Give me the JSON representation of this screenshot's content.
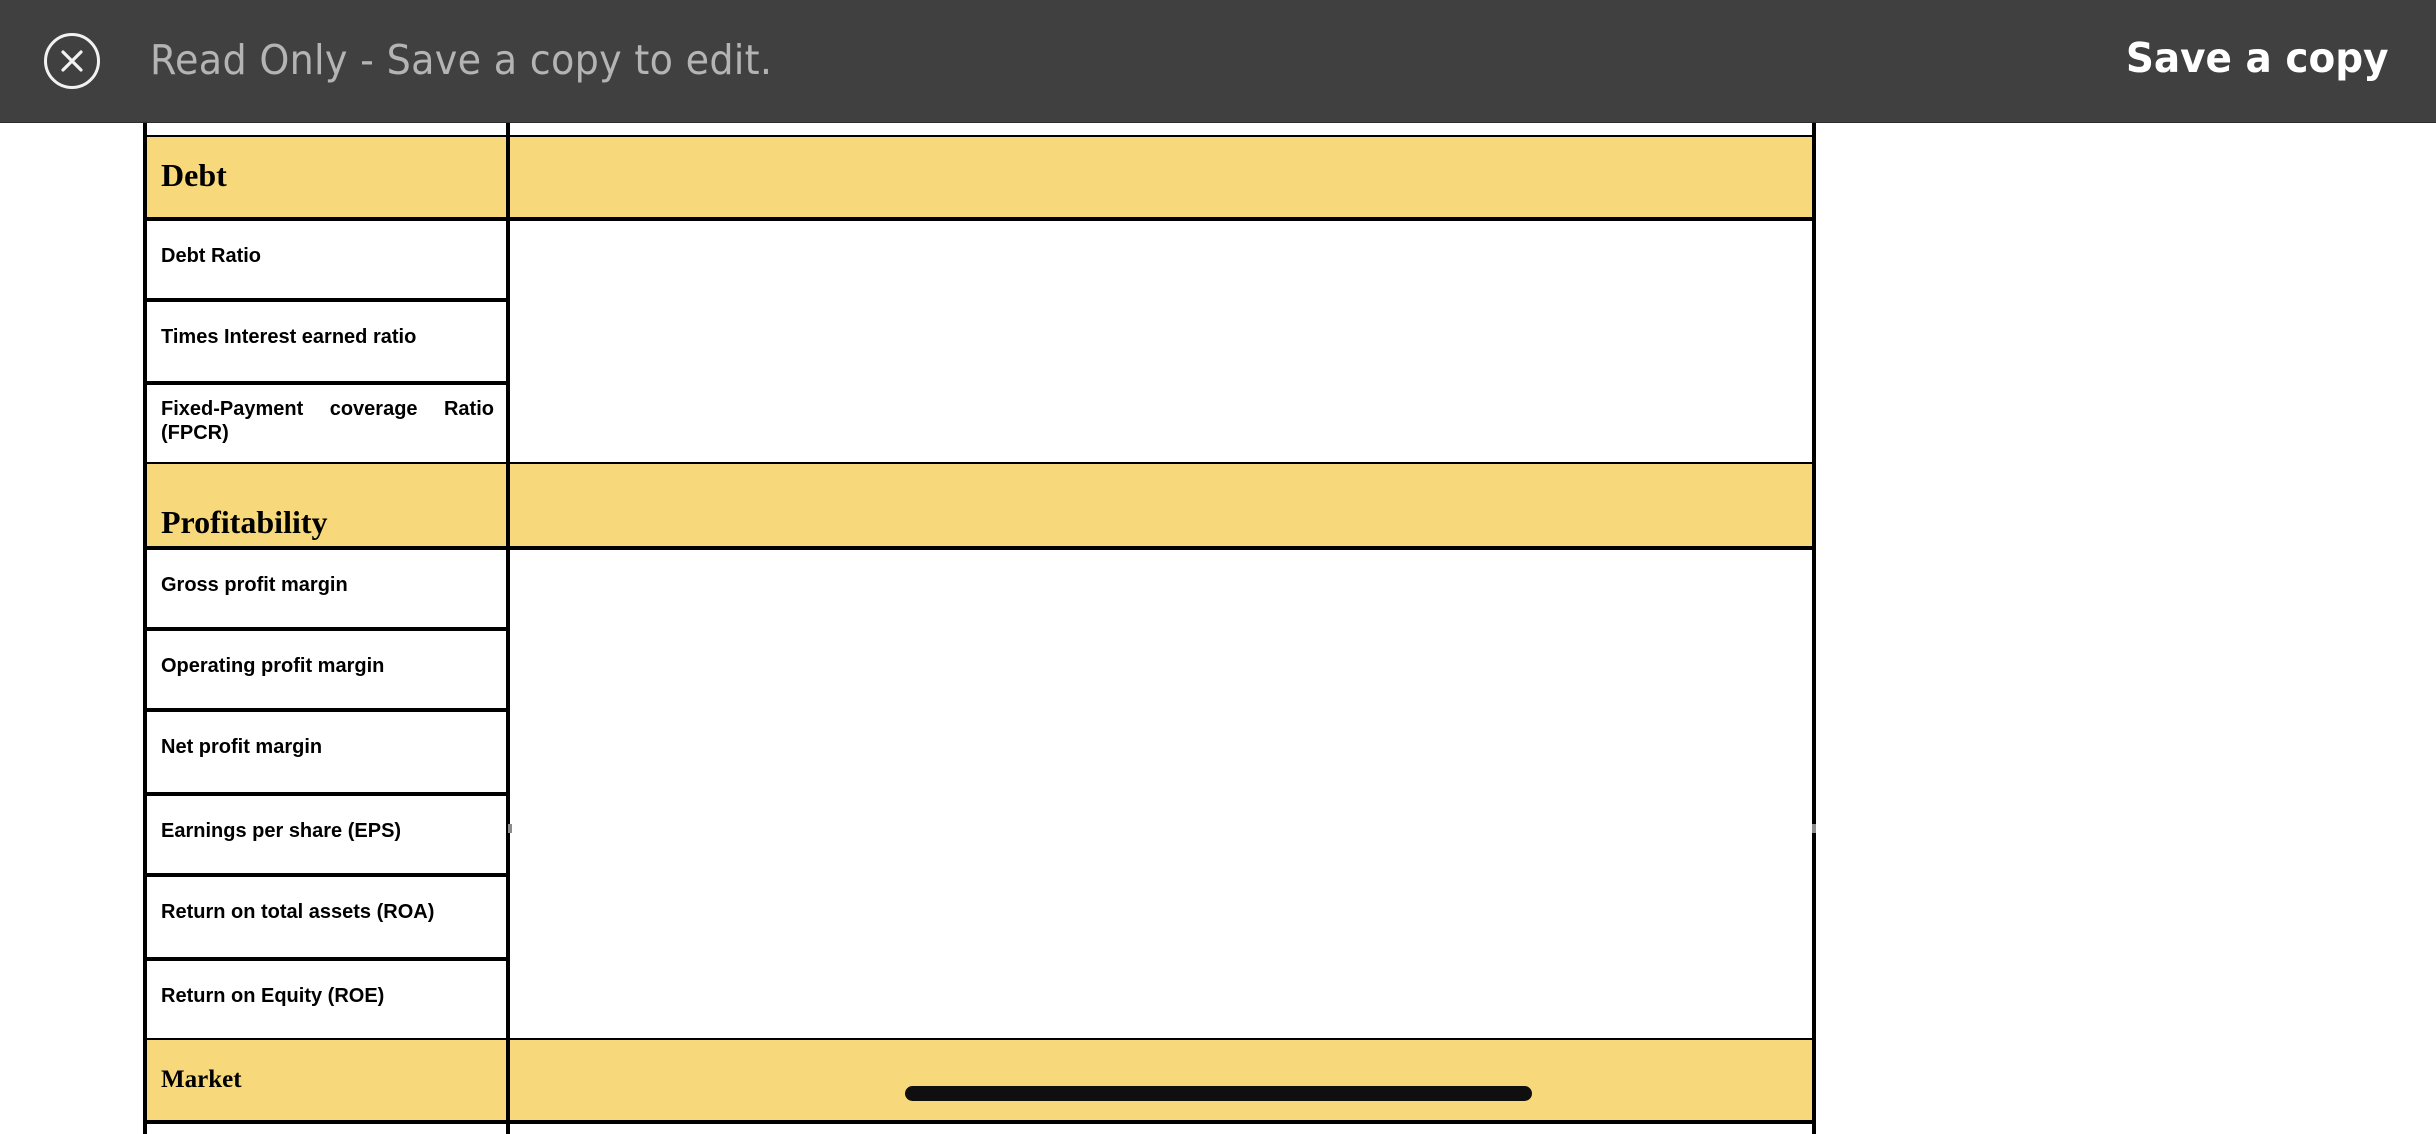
{
  "toolbar": {
    "close_icon": "close-circle-x-icon",
    "read_only_message": "Read Only - Save a copy to edit.",
    "save_copy_label": "Save a copy"
  },
  "colors": {
    "toolbar_background": "#404040",
    "section_fill": "#f7d97b",
    "border": "#000000"
  },
  "table": {
    "sections": [
      {
        "title": "Debt",
        "rows": [
          {
            "label": "Debt Ratio",
            "value": ""
          },
          {
            "label": "Times Interest earned ratio",
            "value": ""
          },
          {
            "label": "Fixed-Payment coverage Ratio (FPCR)",
            "value": ""
          }
        ]
      },
      {
        "title": "Profitability",
        "rows": [
          {
            "label": "Gross profit margin",
            "value": ""
          },
          {
            "label": "Operating profit margin",
            "value": ""
          },
          {
            "label": "Net profit margin",
            "value": ""
          },
          {
            "label": "Earnings per share (EPS)",
            "value": ""
          },
          {
            "label": "Return on total assets (ROA)",
            "value": ""
          },
          {
            "label": "Return on Equity (ROE)",
            "value": ""
          }
        ]
      },
      {
        "title": "Market",
        "rows": []
      }
    ]
  }
}
